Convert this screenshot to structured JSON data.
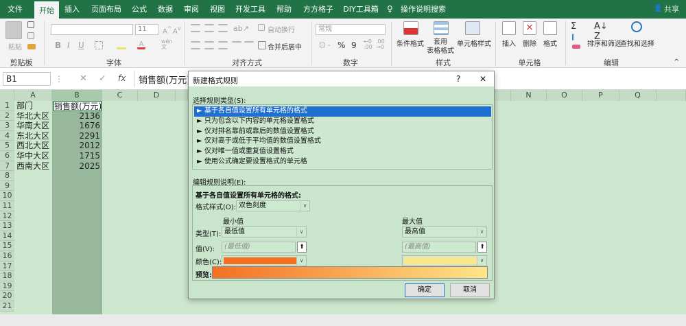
{
  "tabs": [
    "文件",
    "开始",
    "插入",
    "页面布局",
    "公式",
    "数据",
    "审阅",
    "视图",
    "开发工具",
    "帮助",
    "方方格子",
    "DIY工具箱",
    "操作说明搜索"
  ],
  "share_label": "共享",
  "ribbon": {
    "clipboard": {
      "paste": "粘贴",
      "label": "剪贴板"
    },
    "font": {
      "label": "字体",
      "size": "11",
      "bold": "B",
      "italic": "I",
      "underline": "U"
    },
    "alignment": {
      "wrap": "自动换行",
      "merge": "合并后居中",
      "label": "对齐方式"
    },
    "number": {
      "format": "常规",
      "percent": "%",
      "comma": "9",
      "label": "数字"
    },
    "styles": {
      "cond": "条件格式",
      "table": "套用\n表格格式",
      "cell": "单元格样式",
      "label": "样式"
    },
    "cells": {
      "insert": "插入",
      "delete": "删除",
      "format": "格式",
      "label": "单元格"
    },
    "editing": {
      "sort": "排序和筛选",
      "find": "查找和选择",
      "label": "编辑",
      "sigma": "Σ"
    }
  },
  "formula_bar": {
    "name_box": "B1",
    "fx": "fx",
    "content": "销售额(万元)"
  },
  "columns": [
    "A",
    "B",
    "C",
    "D",
    "",
    "",
    "",
    "",
    "",
    "",
    "N",
    "O",
    "P",
    "Q"
  ],
  "rows": [
    "1",
    "2",
    "3",
    "4",
    "5",
    "6",
    "7",
    "8",
    "9",
    "10",
    "11",
    "12",
    "13",
    "14",
    "15",
    "16",
    "17",
    "18",
    "19",
    "20",
    "21"
  ],
  "table": {
    "headers": [
      "部门",
      "销售额(万元)"
    ],
    "rows": [
      [
        "华北大区",
        "2136"
      ],
      [
        "华南大区",
        "1676"
      ],
      [
        "东北大区",
        "2291"
      ],
      [
        "西北大区",
        "2012"
      ],
      [
        "华中大区",
        "1715"
      ],
      [
        "西南大区",
        "2025"
      ]
    ]
  },
  "dialog": {
    "title": "新建格式规则",
    "help": "?",
    "close": "✕",
    "select_label": "选择规则类型(S):",
    "rule_types": [
      "► 基于各自值设置所有单元格的格式",
      "► 只为包含以下内容的单元格设置格式",
      "► 仅对排名靠前或靠后的数值设置格式",
      "► 仅对高于或低于平均值的数值设置格式",
      "► 仅对唯一值或重复值设置格式",
      "► 使用公式确定要设置格式的单元格"
    ],
    "edit_label": "编辑规则说明(E):",
    "section_title": "基于各自值设置所有单元格的格式:",
    "format_style_label": "格式样式(O):",
    "format_style_value": "双色刻度",
    "min_header": "最小值",
    "max_header": "最大值",
    "type_label": "类型(T):",
    "min_type": "最低值",
    "max_type": "最高值",
    "value_label": "值(V):",
    "min_value": "(最低值)",
    "max_value": "(最高值)",
    "color_label": "颜色(C):",
    "min_color": "#f46f22",
    "max_color": "#fde68a",
    "preview_label": "预览:",
    "ok": "确定",
    "cancel": "取消"
  }
}
